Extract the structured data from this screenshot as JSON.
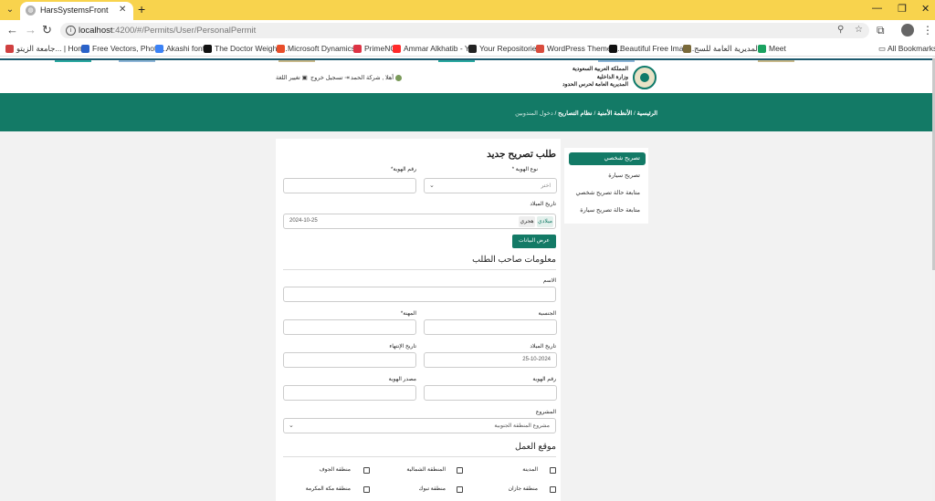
{
  "browser": {
    "tab_title": "HarsSystemsFront",
    "tab_favicon": "globe-icon",
    "url_host": "localhost",
    "url_path": ":4200/#/Permits/User/PersonalPermit",
    "bookmarks": [
      {
        "label": "جامعة الزيتو... | Home",
        "color": "#d04040"
      },
      {
        "label": "Free Vectors, Photo...",
        "color": "#2a62c9"
      },
      {
        "label": "Akashi font",
        "color": "#3b82f6"
      },
      {
        "label": "The Doctor Weighs...",
        "color": "#111111"
      },
      {
        "label": "Microsoft Dynamics...",
        "color": "#e94e2a"
      },
      {
        "label": "PrimeNG",
        "color": "#dd3344"
      },
      {
        "label": "Ammar Alkhatib - Y...",
        "color": "#ff2a2a"
      },
      {
        "label": "Your Repositories",
        "color": "#222222"
      },
      {
        "label": "WordPress Themes...",
        "color": "#d94c3d"
      },
      {
        "label": "Beautiful Free Imag...",
        "color": "#111111"
      },
      {
        "label": "المديرية العامة للسج...",
        "color": "#7a6a3a"
      },
      {
        "label": "Meet",
        "color": "#1aa260"
      }
    ],
    "all_bookmarks": "All Bookmarks"
  },
  "header": {
    "org_line1": "المملكة العربية السعودية",
    "org_line2": "وزارة الداخلية",
    "org_line3": "المديرية العامة لحرس الحدود",
    "greeting": "أهلا , شركة الحمد",
    "logout": "تسجيل خروج",
    "change_lang": "تغيير اللغة"
  },
  "breadcrumb": {
    "home": "الرئيسية",
    "systems": "الأنظمة الأمنية",
    "permits": "نظام التصاريح",
    "current": "دخول المندوبين",
    "sep": "/"
  },
  "sidebar": {
    "items": [
      {
        "label": "تصريح شخصي",
        "active": true
      },
      {
        "label": "تصريح سيارة",
        "active": false
      },
      {
        "label": "متابعة حالة تصريح شخصي",
        "active": false
      },
      {
        "label": "متابعة حالة تصريح سيارة",
        "active": false
      }
    ]
  },
  "form": {
    "title": "طلب تصريح جديد",
    "id_type_label": "نوع الهوية *",
    "id_type_placeholder": "اختر",
    "id_number_label": "رقم الهوية*",
    "birth_date_label": "تاريخ الميلاد",
    "calendar_gregorian": "ميلادي",
    "calendar_hijri": "هجري",
    "birth_date_value": "2024-10-25",
    "show_data_button": "عرض البيانات",
    "owner_section_title": "معلومات صاحب الطلب",
    "name_label": "الاسم",
    "nationality_label": "الجنسية",
    "profession_label": "المهنة*",
    "dob_label": "تاريخ الميلاد",
    "dob_value": "25-10-2024",
    "expiry_label": "تاريخ الإنتهاء",
    "id_number2_label": "رقم الهوية",
    "id_source_label": "مصدر الهوية",
    "project_label": "المشروع",
    "project_value": "مشروع المنطقة الجنوبية",
    "work_location_title": "موقع العمل",
    "locations": [
      [
        "المدينة",
        "المنطقة الشمالية",
        "منطقة الجوف"
      ],
      [
        "منطقة جازان",
        "منطقة تبوك",
        "منطقة مكة المكرمة"
      ]
    ]
  }
}
